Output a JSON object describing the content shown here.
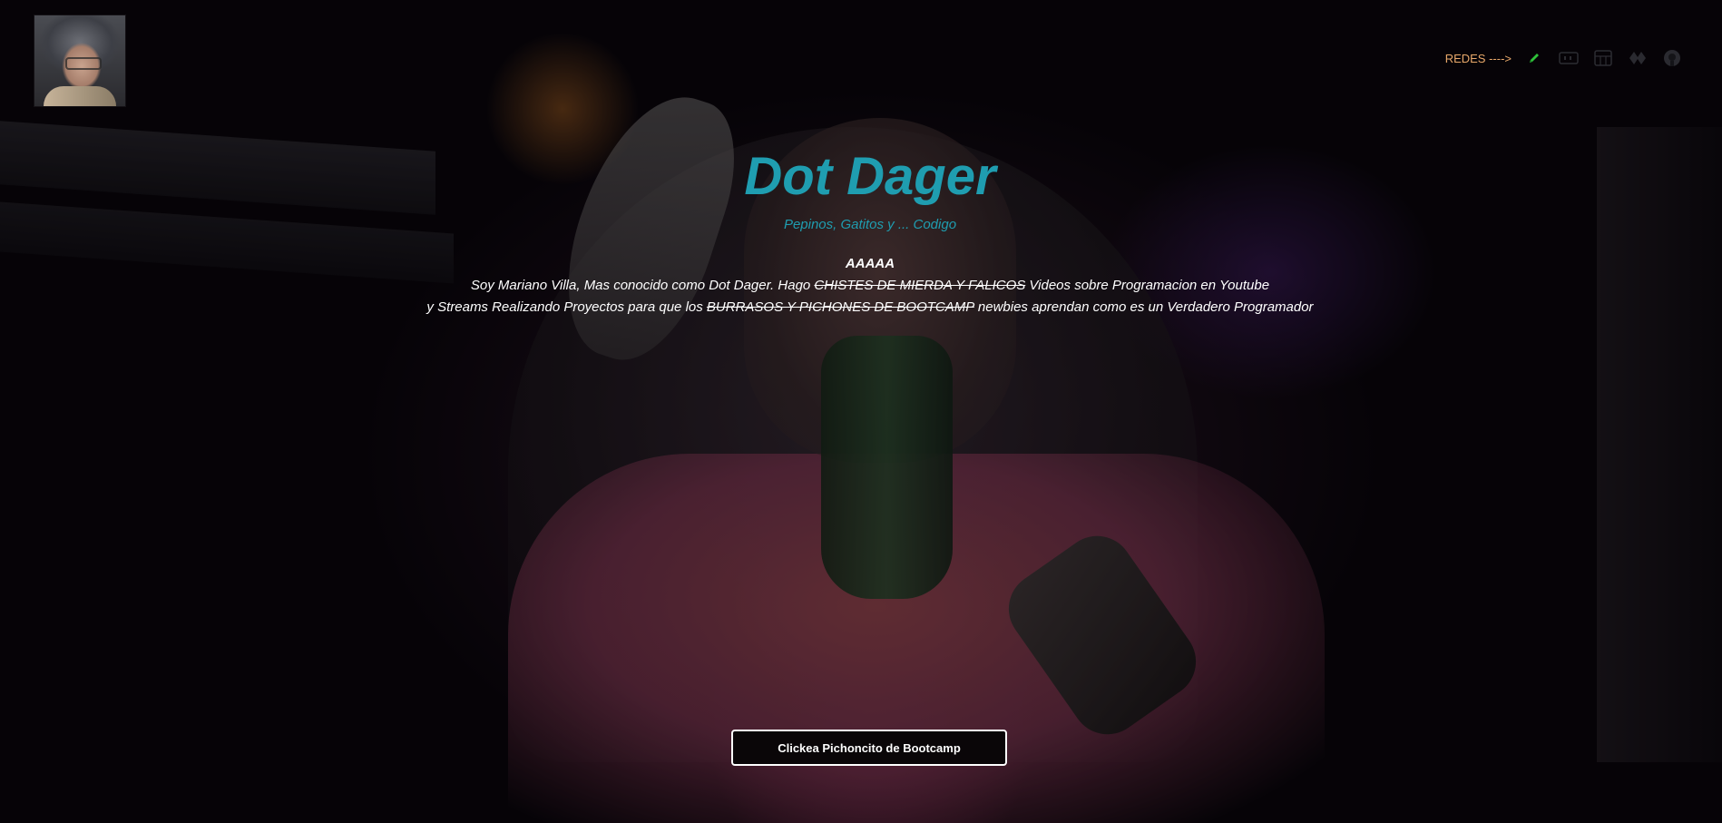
{
  "header": {
    "avatar_alt": "profile-picture",
    "nav": {
      "label": "REDES ---->",
      "icons": [
        "pencil-icon",
        "twitch-icon",
        "youtube-icon",
        "discord-icon",
        "github-icon"
      ]
    }
  },
  "hero": {
    "title": "Dot Dager",
    "subtitle": "Pepinos, Gatitos y ... Codigo",
    "bio": {
      "line0": "AAAAA",
      "line1_a": "Soy Mariano Villa, Mas conocido como Dot Dager. Hago ",
      "line1_struck": "CHISTES DE MIERDA Y FALICOS",
      "line1_b": " Videos sobre Programacion en Youtube",
      "line2_a": "y Streams Realizando Proyectos para que los ",
      "line2_struck": "BURRASOS Y PICHONES DE BOOTCAMP",
      "line2_b": " newbies aprendan como es un Verdadero Programador"
    },
    "cta_label": "Clickea Pichoncito de Bootcamp"
  },
  "colors": {
    "accent": "#1f9db0",
    "nav_label": "#e8a86a",
    "pencil_icon": "#2fc23a",
    "text": "#ffffff"
  }
}
